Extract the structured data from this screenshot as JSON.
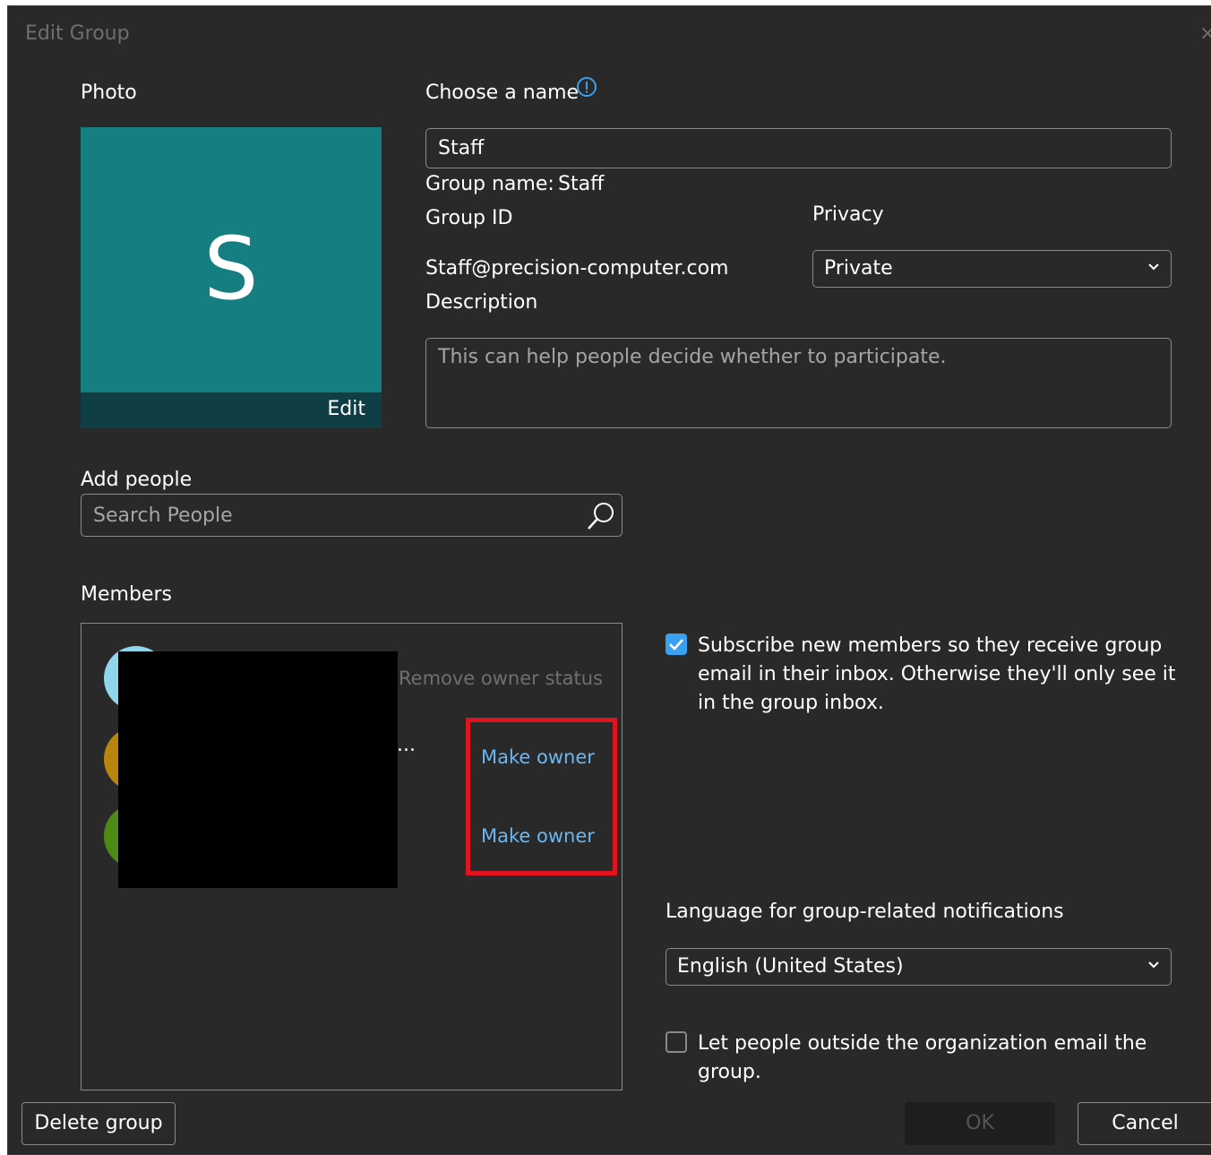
{
  "dialog": {
    "title": "Edit Group",
    "close_glyph": "×"
  },
  "photo": {
    "label": "Photo",
    "letter": "S",
    "edit_label": "Edit",
    "bg_color": "#157e80"
  },
  "name": {
    "label": "Choose a name",
    "value": "Staff",
    "info_icon": "info-icon"
  },
  "group_name": {
    "label": "Group name:",
    "value": "Staff"
  },
  "group_id": {
    "label": "Group ID",
    "value": "Staff@precision-computer.com"
  },
  "privacy": {
    "label": "Privacy",
    "selected": "Private"
  },
  "description": {
    "label": "Description",
    "placeholder": "This can help people decide whether to participate."
  },
  "add_people": {
    "label": "Add people",
    "placeholder": "Search People",
    "icon": "search-icon"
  },
  "members": {
    "label": "Members",
    "items": [
      {
        "action": "Remove owner status",
        "avatar_color": "#8fd6ec"
      },
      {
        "action": "Make owner",
        "avatar_color": "#b8860b",
        "truncation": "..."
      },
      {
        "action": "Make owner",
        "avatar_color": "#4e8a12"
      }
    ]
  },
  "subscribe": {
    "checked": true,
    "text_lines": [
      "Subscribe new members so they receive group",
      "email in their inbox. Otherwise they'll only see it",
      "in the group inbox."
    ]
  },
  "language": {
    "label": "Language for group-related notifications",
    "selected": "English (United States)"
  },
  "outside": {
    "checked": false,
    "text_lines": [
      "Let people outside the organization email the",
      "group."
    ]
  },
  "buttons": {
    "delete": "Delete group",
    "ok": "OK",
    "cancel": "Cancel"
  },
  "colors": {
    "background": "#292929",
    "link": "#6ab7f4",
    "accent": "#3aa0f0",
    "highlight": "#e0141e"
  }
}
